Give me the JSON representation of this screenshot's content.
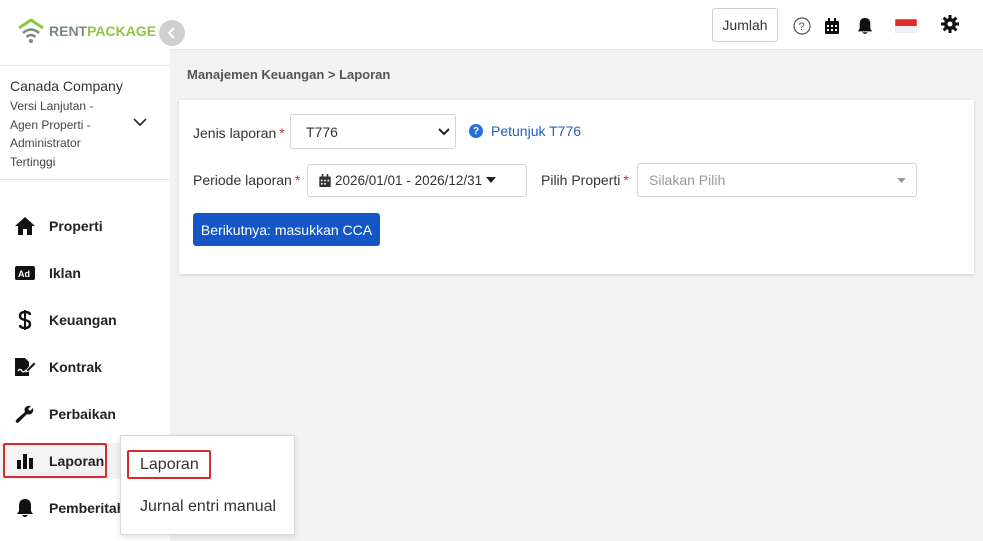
{
  "brand": {
    "rent": "RENT",
    "package": "PACKAGE"
  },
  "company": {
    "name": "Canada Company",
    "subtitle": "Versi Lanjutan - Agen Properti - Administrator Tertinggi"
  },
  "sidebar": {
    "items": [
      {
        "label": "Properti",
        "icon": "home-icon"
      },
      {
        "label": "Iklan",
        "icon": "ad-icon"
      },
      {
        "label": "Keuangan",
        "icon": "dollar-icon"
      },
      {
        "label": "Kontrak",
        "icon": "contract-icon"
      },
      {
        "label": "Perbaikan",
        "icon": "wrench-icon"
      },
      {
        "label": "Laporan",
        "icon": "bar-chart-icon"
      },
      {
        "label": "Pemberitah",
        "icon": "bell-icon"
      }
    ]
  },
  "topbar": {
    "jumlah_label": "Jumlah",
    "icons": [
      "help-icon",
      "calendar-icon",
      "bell-icon",
      "flag-icon",
      "gear-icon"
    ]
  },
  "breadcrumb": "Manajemen Keuangan > Laporan",
  "form": {
    "report_type_label": "Jenis laporan",
    "report_type_value": "T776",
    "help_link": "Petunjuk T776",
    "period_label": "Periode laporan",
    "period_value": "2026/01/01 - 2026/12/31",
    "property_label": "Pilih Properti",
    "property_placeholder": "Silakan Pilih",
    "required_mark": "*",
    "next_button": "Berikutnya: masukkan CCA"
  },
  "submenu": {
    "items": [
      "Laporan",
      "Jurnal entri manual"
    ]
  },
  "colors": {
    "primary": "#1556c7",
    "highlight": "#d52b2b",
    "brand_green": "#8cc63f"
  }
}
